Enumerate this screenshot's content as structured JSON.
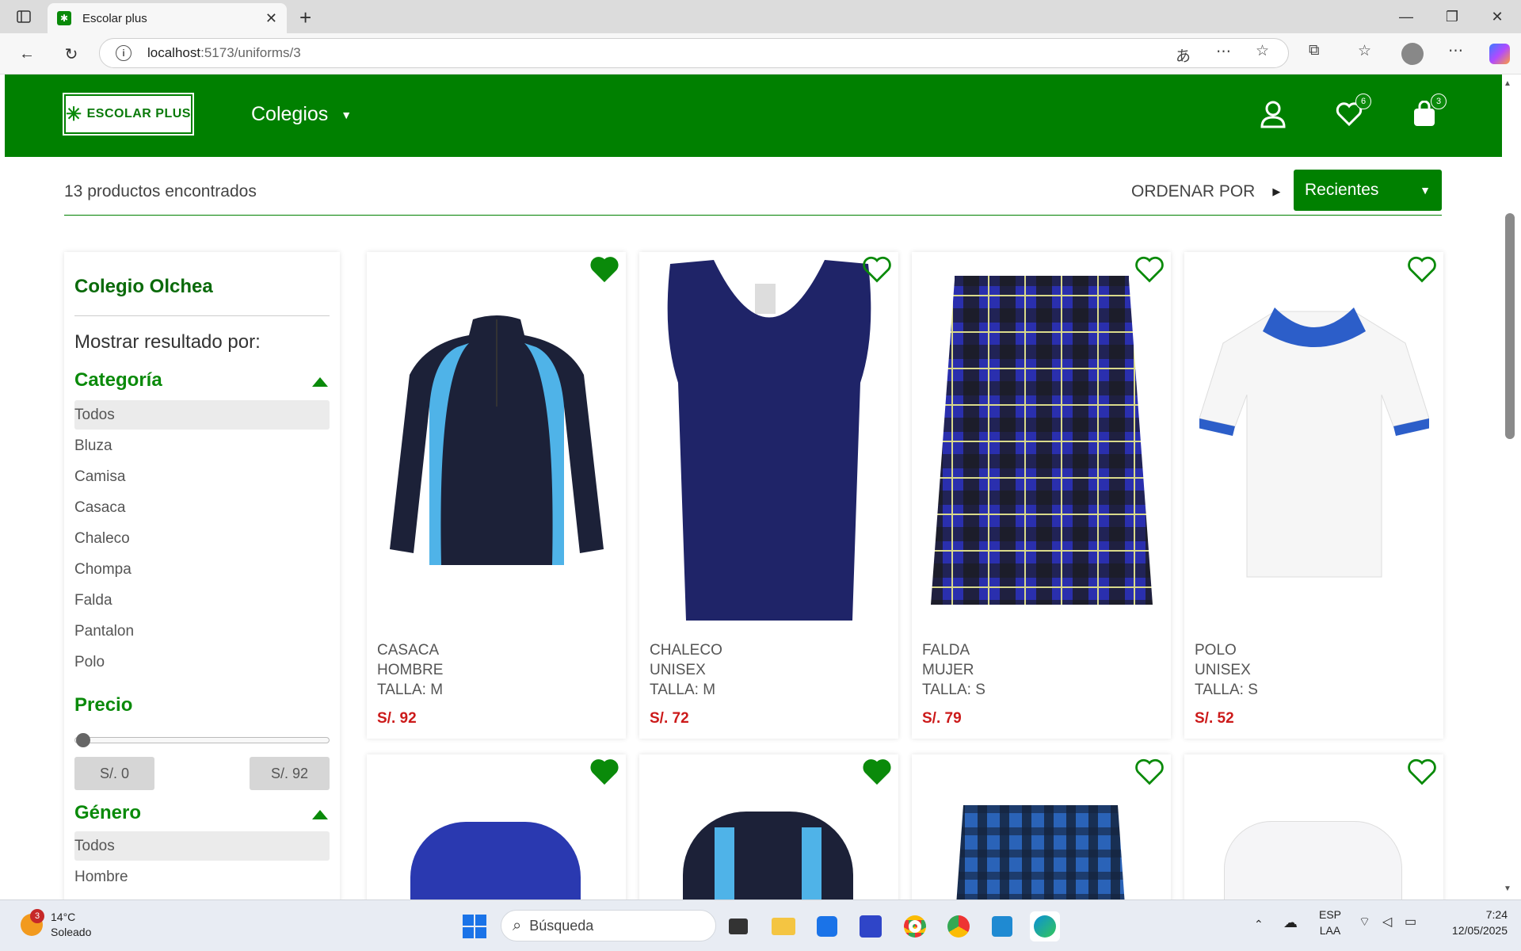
{
  "browser": {
    "tab_title": "Escolar plus",
    "url_host": "localhost",
    "url_path": ":5173/uniforms/3"
  },
  "header": {
    "logo_text": "ESCOLAR PLUS",
    "nav_label": "Colegios",
    "favorites_count": "6",
    "cart_count": "3"
  },
  "results": {
    "count_text": "13 productos encontrados",
    "sort_label": "ORDENAR POR",
    "sort_value": "Recientes"
  },
  "sidebar": {
    "school": "Colegio Olchea",
    "show_label": "Mostrar resultado por:",
    "category_title": "Categoría",
    "categories": [
      "Todos",
      "Bluza",
      "Camisa",
      "Casaca",
      "Chaleco",
      "Chompa",
      "Falda",
      "Pantalon",
      "Polo"
    ],
    "price_title": "Precio",
    "price_min": "S/. 0",
    "price_max": "S/. 92",
    "gender_title": "Género",
    "genders": [
      "Todos",
      "Hombre"
    ]
  },
  "products": [
    {
      "type": "CASACA",
      "gender": "HOMBRE",
      "size": "TALLA: M",
      "price": "S/. 92",
      "favorite": true
    },
    {
      "type": "CHALECO",
      "gender": "UNISEX",
      "size": "TALLA: M",
      "price": "S/. 72",
      "favorite": false
    },
    {
      "type": "FALDA",
      "gender": "MUJER",
      "size": "TALLA: S",
      "price": "S/. 79",
      "favorite": false
    },
    {
      "type": "POLO",
      "gender": "UNISEX",
      "size": "TALLA: S",
      "price": "S/. 52",
      "favorite": false
    },
    {
      "favorite": true
    },
    {
      "favorite": true
    },
    {
      "favorite": false
    },
    {
      "favorite": false
    }
  ],
  "taskbar": {
    "weather_temp": "14°C",
    "weather_desc": "Soleado",
    "weather_badge": "3",
    "search_placeholder": "Búsqueda",
    "lang": "ESP",
    "layout": "LAA",
    "time": "7:24",
    "date": "12/05/2025"
  },
  "colors": {
    "brand": "#008000",
    "price": "#cc1a1a"
  }
}
